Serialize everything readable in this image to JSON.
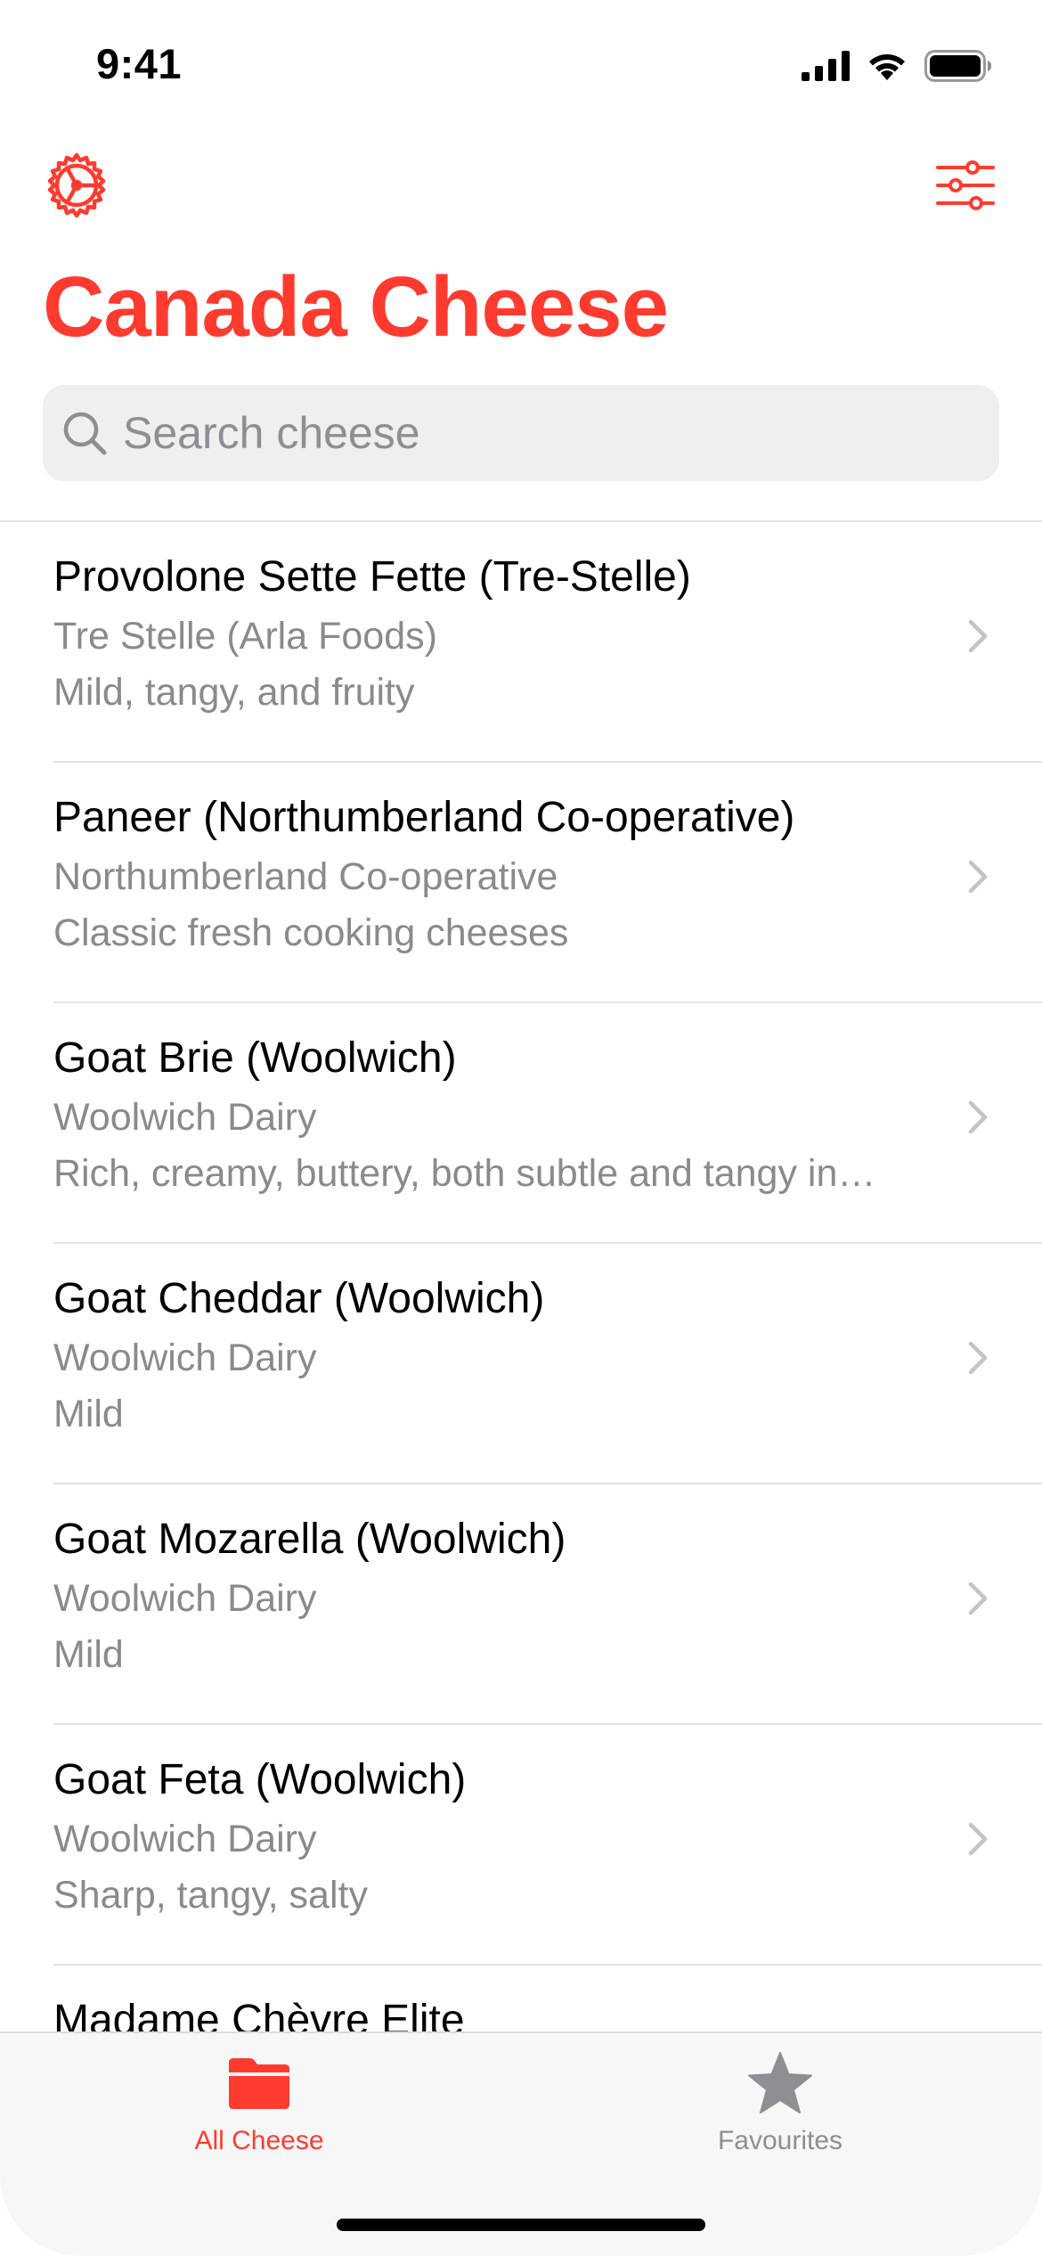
{
  "status_bar": {
    "time": "9:41"
  },
  "nav": {
    "title": "Canada Cheese",
    "left_icon": "gear-icon",
    "right_icon": "sliders-icon"
  },
  "search": {
    "placeholder": "Search cheese",
    "value": ""
  },
  "colors": {
    "accent": "#FF3B30",
    "secondary_text": "#8A8A8E",
    "search_bg": "#EFEFF0",
    "divider": "#E2E2E4",
    "tab_inactive": "#8E8E93"
  },
  "cheeses": [
    {
      "name": "Provolone Sette Fette (Tre-Stelle)",
      "maker": "Tre Stelle (Arla Foods)",
      "flavour": "Mild, tangy, and fruity"
    },
    {
      "name": "Paneer (Northumberland Co-operative)",
      "maker": "Northumberland Co-operative",
      "flavour": "Classic fresh cooking cheeses"
    },
    {
      "name": "Goat Brie (Woolwich)",
      "maker": "Woolwich Dairy",
      "flavour": "Rich, creamy, buttery, both subtle and tangy in…"
    },
    {
      "name": "Goat Cheddar (Woolwich)",
      "maker": "Woolwich Dairy",
      "flavour": "Mild"
    },
    {
      "name": "Goat Mozarella (Woolwich)",
      "maker": "Woolwich Dairy",
      "flavour": "Mild"
    },
    {
      "name": "Goat Feta (Woolwich)",
      "maker": "Woolwich Dairy",
      "flavour": "Sharp, tangy, salty"
    },
    {
      "name": "Madame Chèvre Elite",
      "maker": "",
      "flavour": ""
    }
  ],
  "tabs": [
    {
      "label": "All Cheese",
      "icon": "folder-icon",
      "selected": true
    },
    {
      "label": "Favourites",
      "icon": "star-icon",
      "selected": false
    }
  ]
}
